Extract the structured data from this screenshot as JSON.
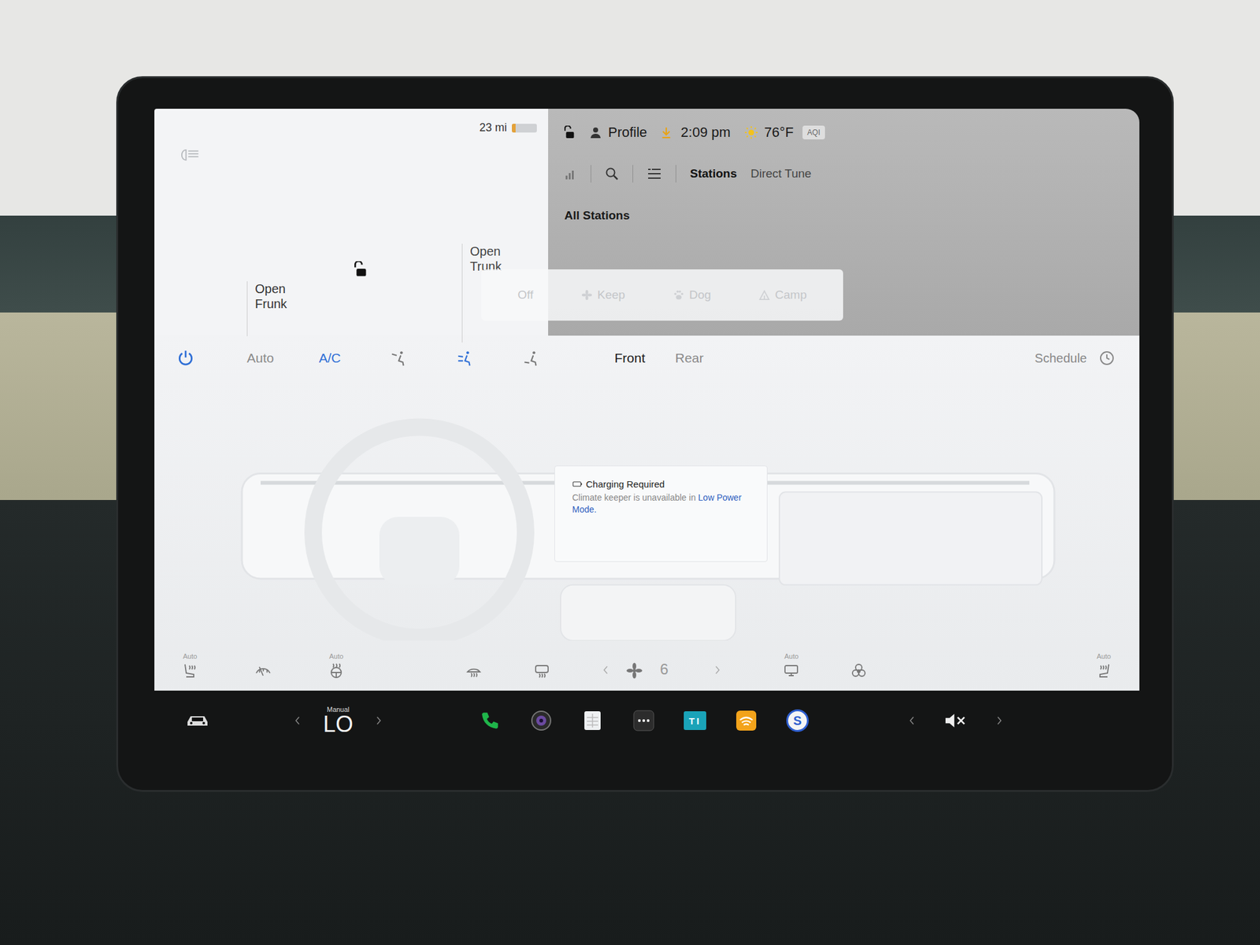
{
  "status_bar": {
    "range": "23 mi",
    "battery_level": 0.15,
    "locked": false,
    "profile": "Profile",
    "downloading": true,
    "time": "2:09 pm",
    "temperature": "76°F",
    "aqi": "AQI"
  },
  "car_panel": {
    "frunk": "Open Frunk",
    "trunk": "Open Trunk",
    "locked": false
  },
  "media": {
    "tabs": [
      {
        "label": "Stations",
        "selected": true
      },
      {
        "label": "Direct Tune",
        "selected": false
      }
    ],
    "heading": "All Stations"
  },
  "keeper_modes": [
    {
      "label": "Off",
      "kind": "none",
      "disabled": true
    },
    {
      "label": "Keep",
      "kind": "fan",
      "disabled": true
    },
    {
      "label": "Dog",
      "kind": "dog",
      "disabled": true
    },
    {
      "label": "Camp",
      "kind": "camp",
      "disabled": true
    }
  ],
  "climate": {
    "power": true,
    "auto": {
      "label": "Auto",
      "on": false
    },
    "ac": {
      "label": "A/C",
      "on": true
    },
    "airflow": [
      {
        "selected": false
      },
      {
        "selected": true
      },
      {
        "selected": false
      }
    ],
    "zones": [
      {
        "label": "Front",
        "selected": true
      },
      {
        "label": "Rear",
        "selected": false
      }
    ],
    "schedule": "Schedule",
    "notice": {
      "title": "Charging Required",
      "text": "Climate keeper is unavailable in ",
      "link": "Low Power Mode."
    },
    "fan_speed": "6",
    "controls": [
      {
        "kind": "seat-left",
        "label": "Auto"
      },
      {
        "kind": "wiper",
        "label": ""
      },
      {
        "kind": "wheel",
        "label": "Auto"
      },
      {
        "kind": "defrost-front",
        "label": ""
      },
      {
        "kind": "defrost-rear",
        "label": ""
      },
      {
        "kind": "fan",
        "label": ""
      },
      {
        "kind": "screen",
        "label": "Auto"
      },
      {
        "kind": "bio",
        "label": ""
      },
      {
        "kind": "seat-right",
        "label": "Auto"
      }
    ]
  },
  "taskbar": {
    "temp_mode": "Manual",
    "temp": "LO",
    "apps": [
      {
        "kind": "phone",
        "label": ""
      },
      {
        "kind": "camera",
        "label": ""
      },
      {
        "kind": "notes",
        "label": ""
      },
      {
        "kind": "more",
        "label": ""
      },
      {
        "kind": "toybox",
        "label": "TI"
      },
      {
        "kind": "audible",
        "label": ""
      },
      {
        "kind": "s",
        "label": "S"
      }
    ],
    "volume_muted": true
  }
}
